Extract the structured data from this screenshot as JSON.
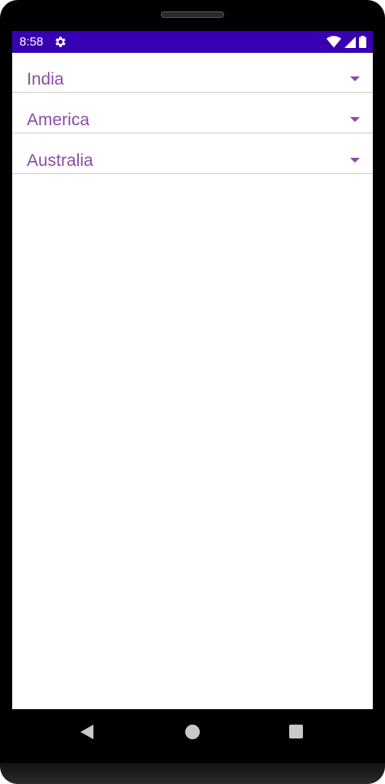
{
  "status_bar": {
    "time": "8:58",
    "icons": [
      "gear-icon",
      "wifi-icon",
      "cell-signal-icon",
      "battery-icon"
    ],
    "background": "#3700b3"
  },
  "spinners": [
    {
      "selected": "India"
    },
    {
      "selected": "America"
    },
    {
      "selected": "Australia"
    }
  ],
  "colors": {
    "accent": "#8f4aa8"
  },
  "nav_bar": {
    "buttons": [
      "back-icon",
      "home-icon",
      "recents-icon"
    ]
  }
}
